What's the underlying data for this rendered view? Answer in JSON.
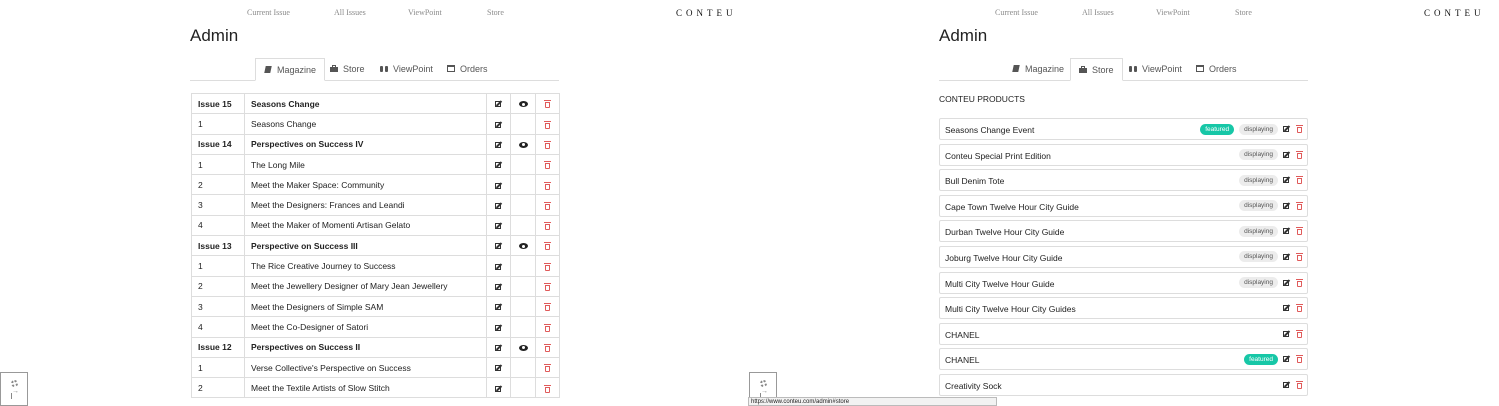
{
  "nav": {
    "links": [
      "Current Issue",
      "All Issues",
      "ViewPoint",
      "Store"
    ],
    "brand": "CONTEU"
  },
  "admin_title": "Admin",
  "tabs": [
    {
      "label": "Magazine",
      "icon": "book-icon"
    },
    {
      "label": "Store",
      "icon": "shopping-bag-icon"
    },
    {
      "label": "ViewPoint",
      "icon": "binoculars-icon"
    },
    {
      "label": "Orders",
      "icon": "credit-card-icon"
    }
  ],
  "left": {
    "active_tab": "Magazine"
  },
  "right": {
    "active_tab": "Store"
  },
  "magazine_rows": [
    {
      "num": "Issue 15",
      "title": "Seasons Change",
      "type": "issue"
    },
    {
      "num": "1",
      "title": "Seasons Change",
      "type": "article"
    },
    {
      "num": "Issue 14",
      "title": "Perspectives on Success IV",
      "type": "issue"
    },
    {
      "num": "1",
      "title": "The Long Mile",
      "type": "article"
    },
    {
      "num": "2",
      "title": "Meet the Maker Space: Community",
      "type": "article"
    },
    {
      "num": "3",
      "title": "Meet the Designers: Frances and Leandi",
      "type": "article"
    },
    {
      "num": "4",
      "title": "Meet the Maker of Momenti Artisan Gelato",
      "type": "article"
    },
    {
      "num": "Issue 13",
      "title": "Perspective on Success III",
      "type": "issue"
    },
    {
      "num": "1",
      "title": "The Rice Creative Journey to Success",
      "type": "article"
    },
    {
      "num": "2",
      "title": "Meet the Jewellery Designer of Mary Jean Jewellery",
      "type": "article"
    },
    {
      "num": "3",
      "title": "Meet the Designers of Simple SAM",
      "type": "article"
    },
    {
      "num": "4",
      "title": "Meet the Co-Designer of Satori",
      "type": "article"
    },
    {
      "num": "Issue 12",
      "title": "Perspectives on Success II",
      "type": "issue"
    },
    {
      "num": "1",
      "title": "Verse Collective's Perspective on Success",
      "type": "article"
    },
    {
      "num": "2",
      "title": "Meet the Textile Artists of Slow Stitch",
      "type": "article"
    }
  ],
  "products_heading": "CONTEU PRODUCTS",
  "badges": {
    "featured": "featured",
    "displaying": "displaying"
  },
  "products": [
    {
      "name": "Seasons Change Event",
      "featured": true,
      "displaying": true
    },
    {
      "name": "Conteu Special Print Edition",
      "featured": false,
      "displaying": true
    },
    {
      "name": "Bull Denim Tote",
      "featured": false,
      "displaying": true
    },
    {
      "name": "Cape Town Twelve Hour City Guide",
      "featured": false,
      "displaying": true
    },
    {
      "name": "Durban Twelve Hour City Guide",
      "featured": false,
      "displaying": true
    },
    {
      "name": "Joburg Twelve Hour City Guide",
      "featured": false,
      "displaying": true
    },
    {
      "name": "Multi City Twelve Hour Guide",
      "featured": false,
      "displaying": true
    },
    {
      "name": "Multi City Twelve Hour City Guides",
      "featured": false,
      "displaying": false
    },
    {
      "name": "CHANEL",
      "featured": false,
      "displaying": false
    },
    {
      "name": "CHANEL",
      "featured": true,
      "displaying": false
    },
    {
      "name": "Creativity Sock",
      "featured": false,
      "displaying": false
    }
  ],
  "status_url": "https://www.conteu.com/admin#store",
  "colors": {
    "featured": "#17c7a7",
    "delete": "#e05a5a",
    "border": "#dddddd"
  }
}
